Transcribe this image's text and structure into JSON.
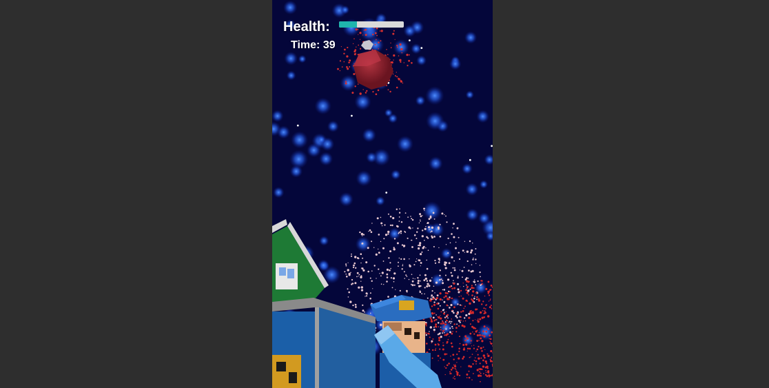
{
  "hud": {
    "health_label": "Health:",
    "health_fraction": 0.28,
    "time_text": "Time: 39"
  },
  "colors": {
    "page_background": "#2e2e2e",
    "night_sky": "#04063a",
    "health_fill": "#1fb5ad",
    "health_track": "#d9d9d9"
  }
}
